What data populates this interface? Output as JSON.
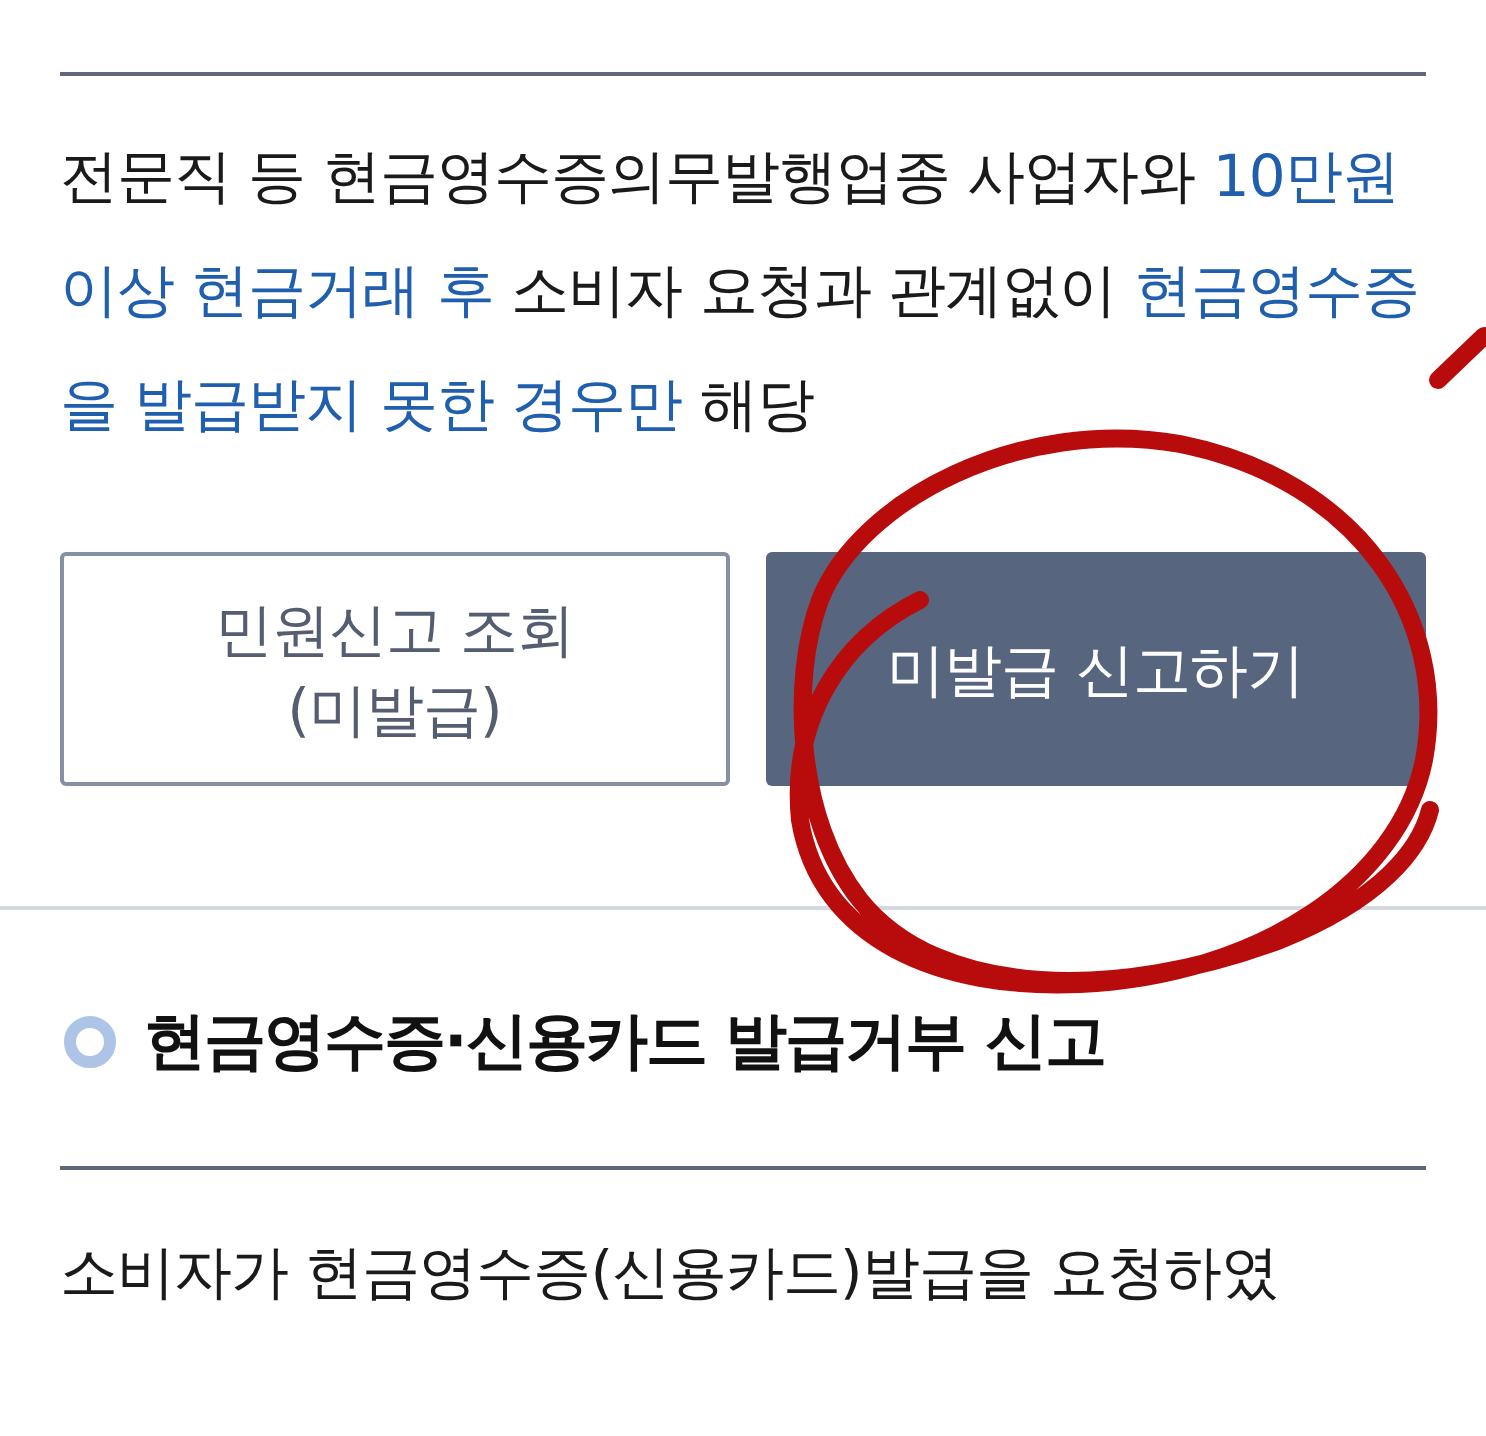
{
  "section_1": {
    "description": [
      {
        "text": "전문직 등 현금영수증의무발행업종 사업자와 ",
        "highlight": false
      },
      {
        "text": "10만원 이상 현금거래 후",
        "highlight": true
      },
      {
        "text": " 소비자 요청과 관계없이 ",
        "highlight": false
      },
      {
        "text": "현금영수증을 발급받지 못한 경우만",
        "highlight": true
      },
      {
        "text": " 해당",
        "highlight": false
      }
    ],
    "buttons": [
      {
        "lines": [
          "민원신고 조회",
          "(미발급)"
        ],
        "kind": "outline"
      },
      {
        "lines": [
          "미발급 신고하기"
        ],
        "kind": "filled"
      }
    ]
  },
  "section_2": {
    "title": "현금영수증·신용카드 발급거부 신고",
    "description": "소비자가 현금영수증(신용카드)발급을 요청하였"
  }
}
